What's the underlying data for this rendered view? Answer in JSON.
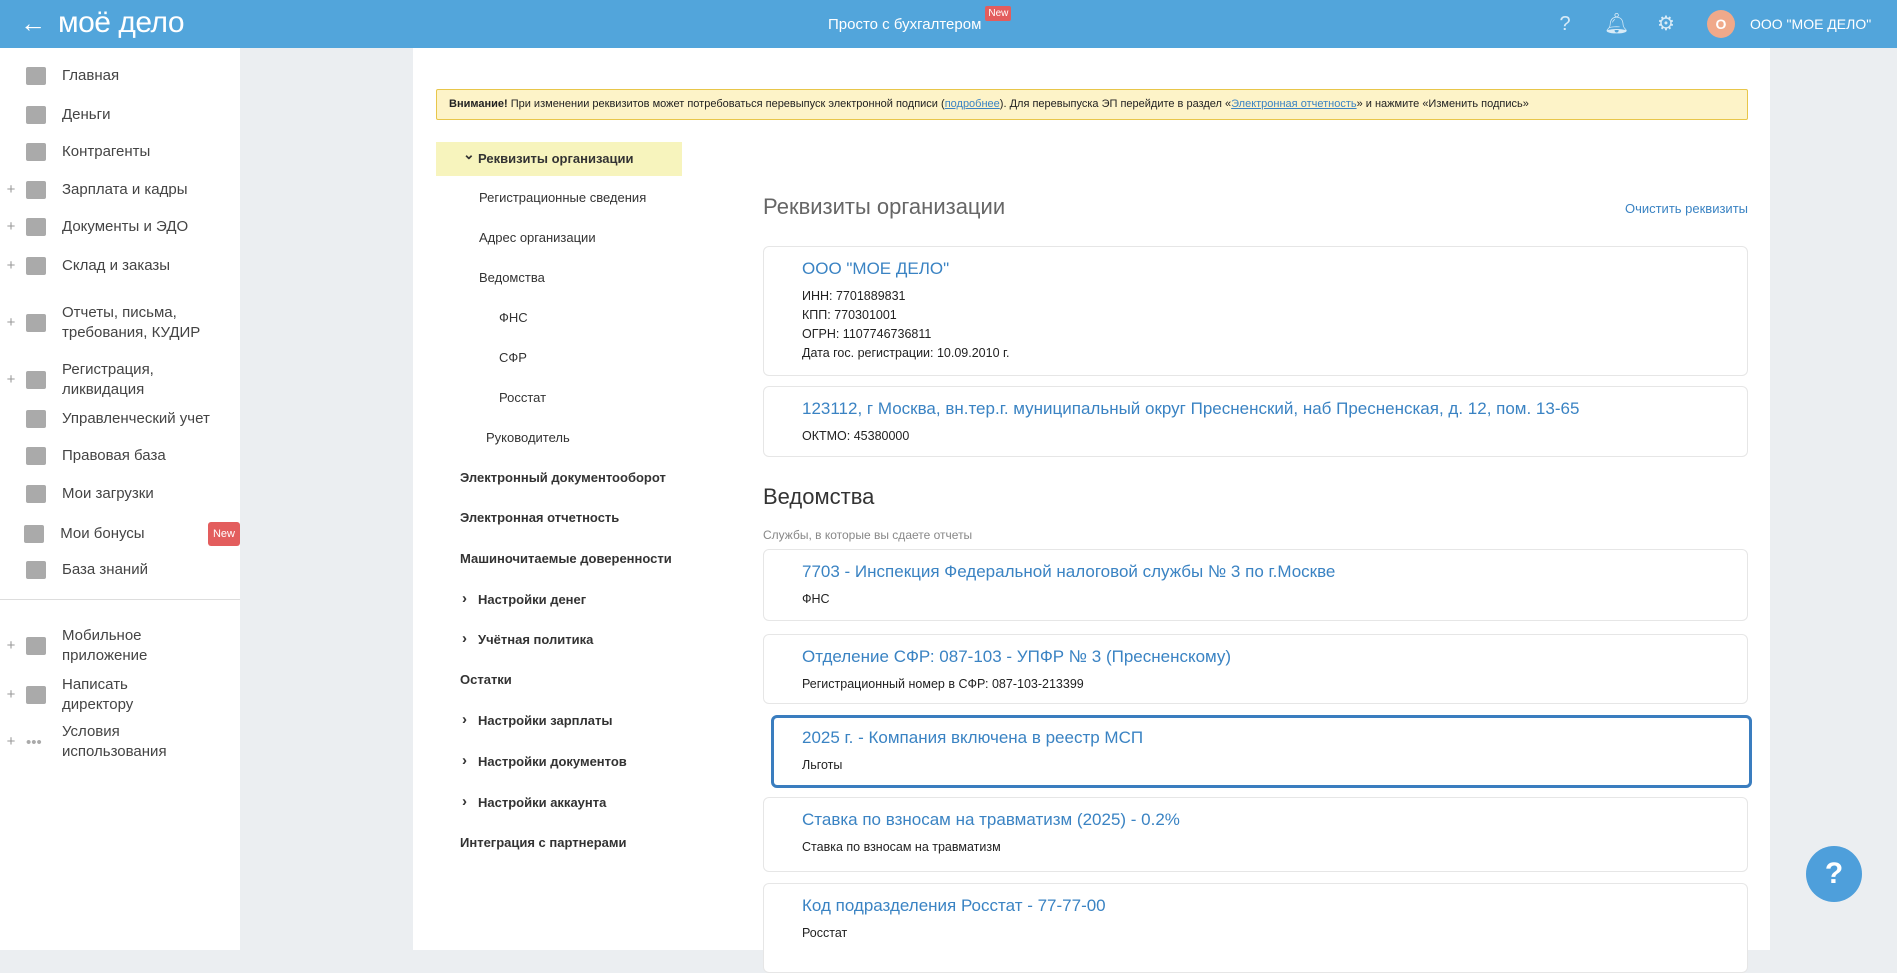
{
  "header": {
    "logo": "моё дело",
    "center_link": "Просто с бухгалтером",
    "new_badge": "New",
    "avatar_letter": "О",
    "org_name": "ООО \"МОЕ ДЕЛО\""
  },
  "sidebar": {
    "items": [
      {
        "label": "Главная",
        "plus": false
      },
      {
        "label": "Деньги",
        "plus": false
      },
      {
        "label": "Контрагенты",
        "plus": false
      },
      {
        "label": "Зарплата и кадры",
        "plus": true
      },
      {
        "label": "Документы и ЭДО",
        "plus": true
      },
      {
        "label": "Склад и заказы",
        "plus": true
      },
      {
        "label": "Отчеты, письма, требования, КУДИР",
        "plus": true
      },
      {
        "label": "Регистрация, ликвидация",
        "plus": true
      },
      {
        "label": "Управленческий учет",
        "plus": false
      },
      {
        "label": "Правовая база",
        "plus": false
      },
      {
        "label": "Мои загрузки",
        "plus": false
      },
      {
        "label": "Мои бонусы",
        "plus": false,
        "badge": "New"
      },
      {
        "label": "База знаний",
        "plus": false
      }
    ],
    "bottom": [
      {
        "label": "Мобильное приложение"
      },
      {
        "label": "Написать директору"
      },
      {
        "label": "Условия использования"
      }
    ]
  },
  "banner": {
    "bold": "Внимание!",
    "text1": " При изменении реквизитов может потребоваться перевыпуск электронной подписи (",
    "link1": "подробнее",
    "text2": "). Для перевыпуска ЭП перейдите в раздел «",
    "link2": "Электронная отчетность",
    "text3": "» и нажмите «Изменить подпись»"
  },
  "nav": [
    "Реквизиты организации",
    "Регистрационные сведения",
    "Адрес организации",
    "Ведомства",
    "ФНС",
    "СФР",
    "Росстат",
    "Руководитель",
    "Электронный документооборот",
    "Электронная отчетность",
    "Машиночитаемые доверенности",
    "Настройки денег",
    "Учётная политика",
    "Остатки",
    "Настройки зарплаты",
    "Настройки документов",
    "Настройки аккаунта",
    "Интеграция с партнерами"
  ],
  "main": {
    "title": "Реквизиты организации",
    "clear": "Очистить реквизиты",
    "org": {
      "name": "ООО  \"МОЕ ДЕЛО\"",
      "inn": "ИНН: 7701889831",
      "kpp": "КПП: 770301001",
      "ogrn": "ОГРН: 1107746736811",
      "date": "Дата гос. регистрации: 10.09.2010 г."
    },
    "address": {
      "title": "123112, г Москва, вн.тер.г. муниципальный округ Пресненский, наб Пресненская, д. 12, пом. 13-65",
      "oktmo": "ОКТМО: 45380000"
    },
    "agencies_title": "Ведомства",
    "agencies_sub": "Службы, в которые вы сдаете отчеты",
    "agencies": [
      {
        "title": "7703 - Инспекция Федеральной налоговой службы № 3 по г.Москве",
        "sub": "ФНС"
      },
      {
        "title": "Отделение СФР: 087-103 - УПФР № 3 (Пресненскому)",
        "sub": "Регистрационный номер в СФР: 087-103-213399"
      },
      {
        "title": "2025 г. - Компания включена в реестр МСП",
        "sub": "Льготы"
      },
      {
        "title": "Ставка по взносам на травматизм (2025) - 0.2%",
        "sub": "Ставка по взносам на травматизм"
      },
      {
        "title": "Код подразделения Росстат - 77-77-00",
        "sub": "Росстат"
      }
    ]
  },
  "fab": "?"
}
